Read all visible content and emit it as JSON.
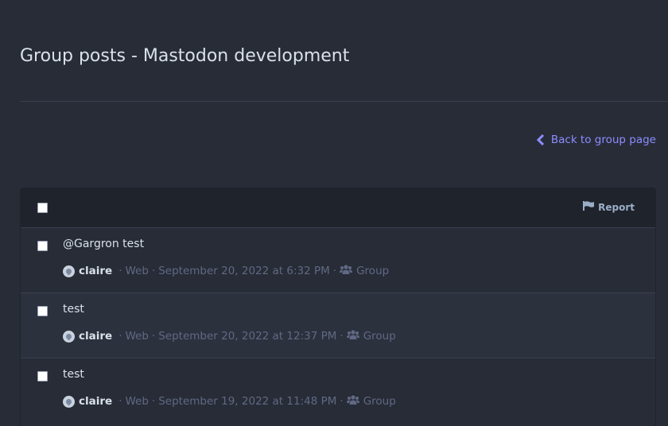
{
  "page": {
    "title": "Group posts - Mastodon development"
  },
  "back": {
    "label": "Back to group page",
    "icon": "chevron-left-icon"
  },
  "toolbar": {
    "report_label": "Report",
    "report_icon": "flag-icon"
  },
  "posts": [
    {
      "mention": "@Gargron",
      "text": " test",
      "author": "claire",
      "app": "Web",
      "date": "September 20, 2022 at 6:32 PM",
      "visibility": "Group"
    },
    {
      "mention": "",
      "text": "test",
      "author": "claire",
      "app": "Web",
      "date": "September 20, 2022 at 12:37 PM",
      "visibility": "Group"
    },
    {
      "mention": "",
      "text": "test",
      "author": "claire",
      "app": "Web",
      "date": "September 19, 2022 at 11:48 PM",
      "visibility": "Group"
    }
  ],
  "colors": {
    "background": "#282c37",
    "accent": "#8c8dff",
    "muted": "#606984",
    "text": "#d9e1e8"
  }
}
